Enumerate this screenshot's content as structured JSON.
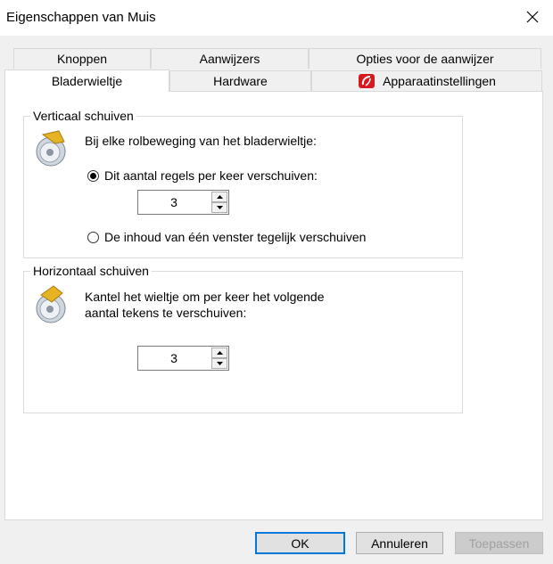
{
  "window": {
    "title": "Eigenschappen van Muis"
  },
  "tabs": {
    "row1": [
      "Knoppen",
      "Aanwijzers",
      "Opties voor de aanwijzer"
    ],
    "row2": [
      "Bladerwieltje",
      "Hardware",
      "Apparaatinstellingen"
    ],
    "active": "Bladerwieltje"
  },
  "vertical": {
    "legend": "Verticaal schuiven",
    "description": "Bij elke rolbeweging van het bladerwieltje:",
    "option_lines": "Dit aantal regels per keer verschuiven:",
    "lines_value": "3",
    "option_page": "De inhoud van één venster tegelijk verschuiven",
    "selected": "option_lines"
  },
  "horizontal": {
    "legend": "Horizontaal schuiven",
    "description_line1": "Kantel het wieltje om per keer het volgende",
    "description_line2": "aantal tekens te verschuiven:",
    "chars_value": "3"
  },
  "buttons": {
    "ok": "OK",
    "cancel": "Annuleren",
    "apply": "Toepassen"
  }
}
